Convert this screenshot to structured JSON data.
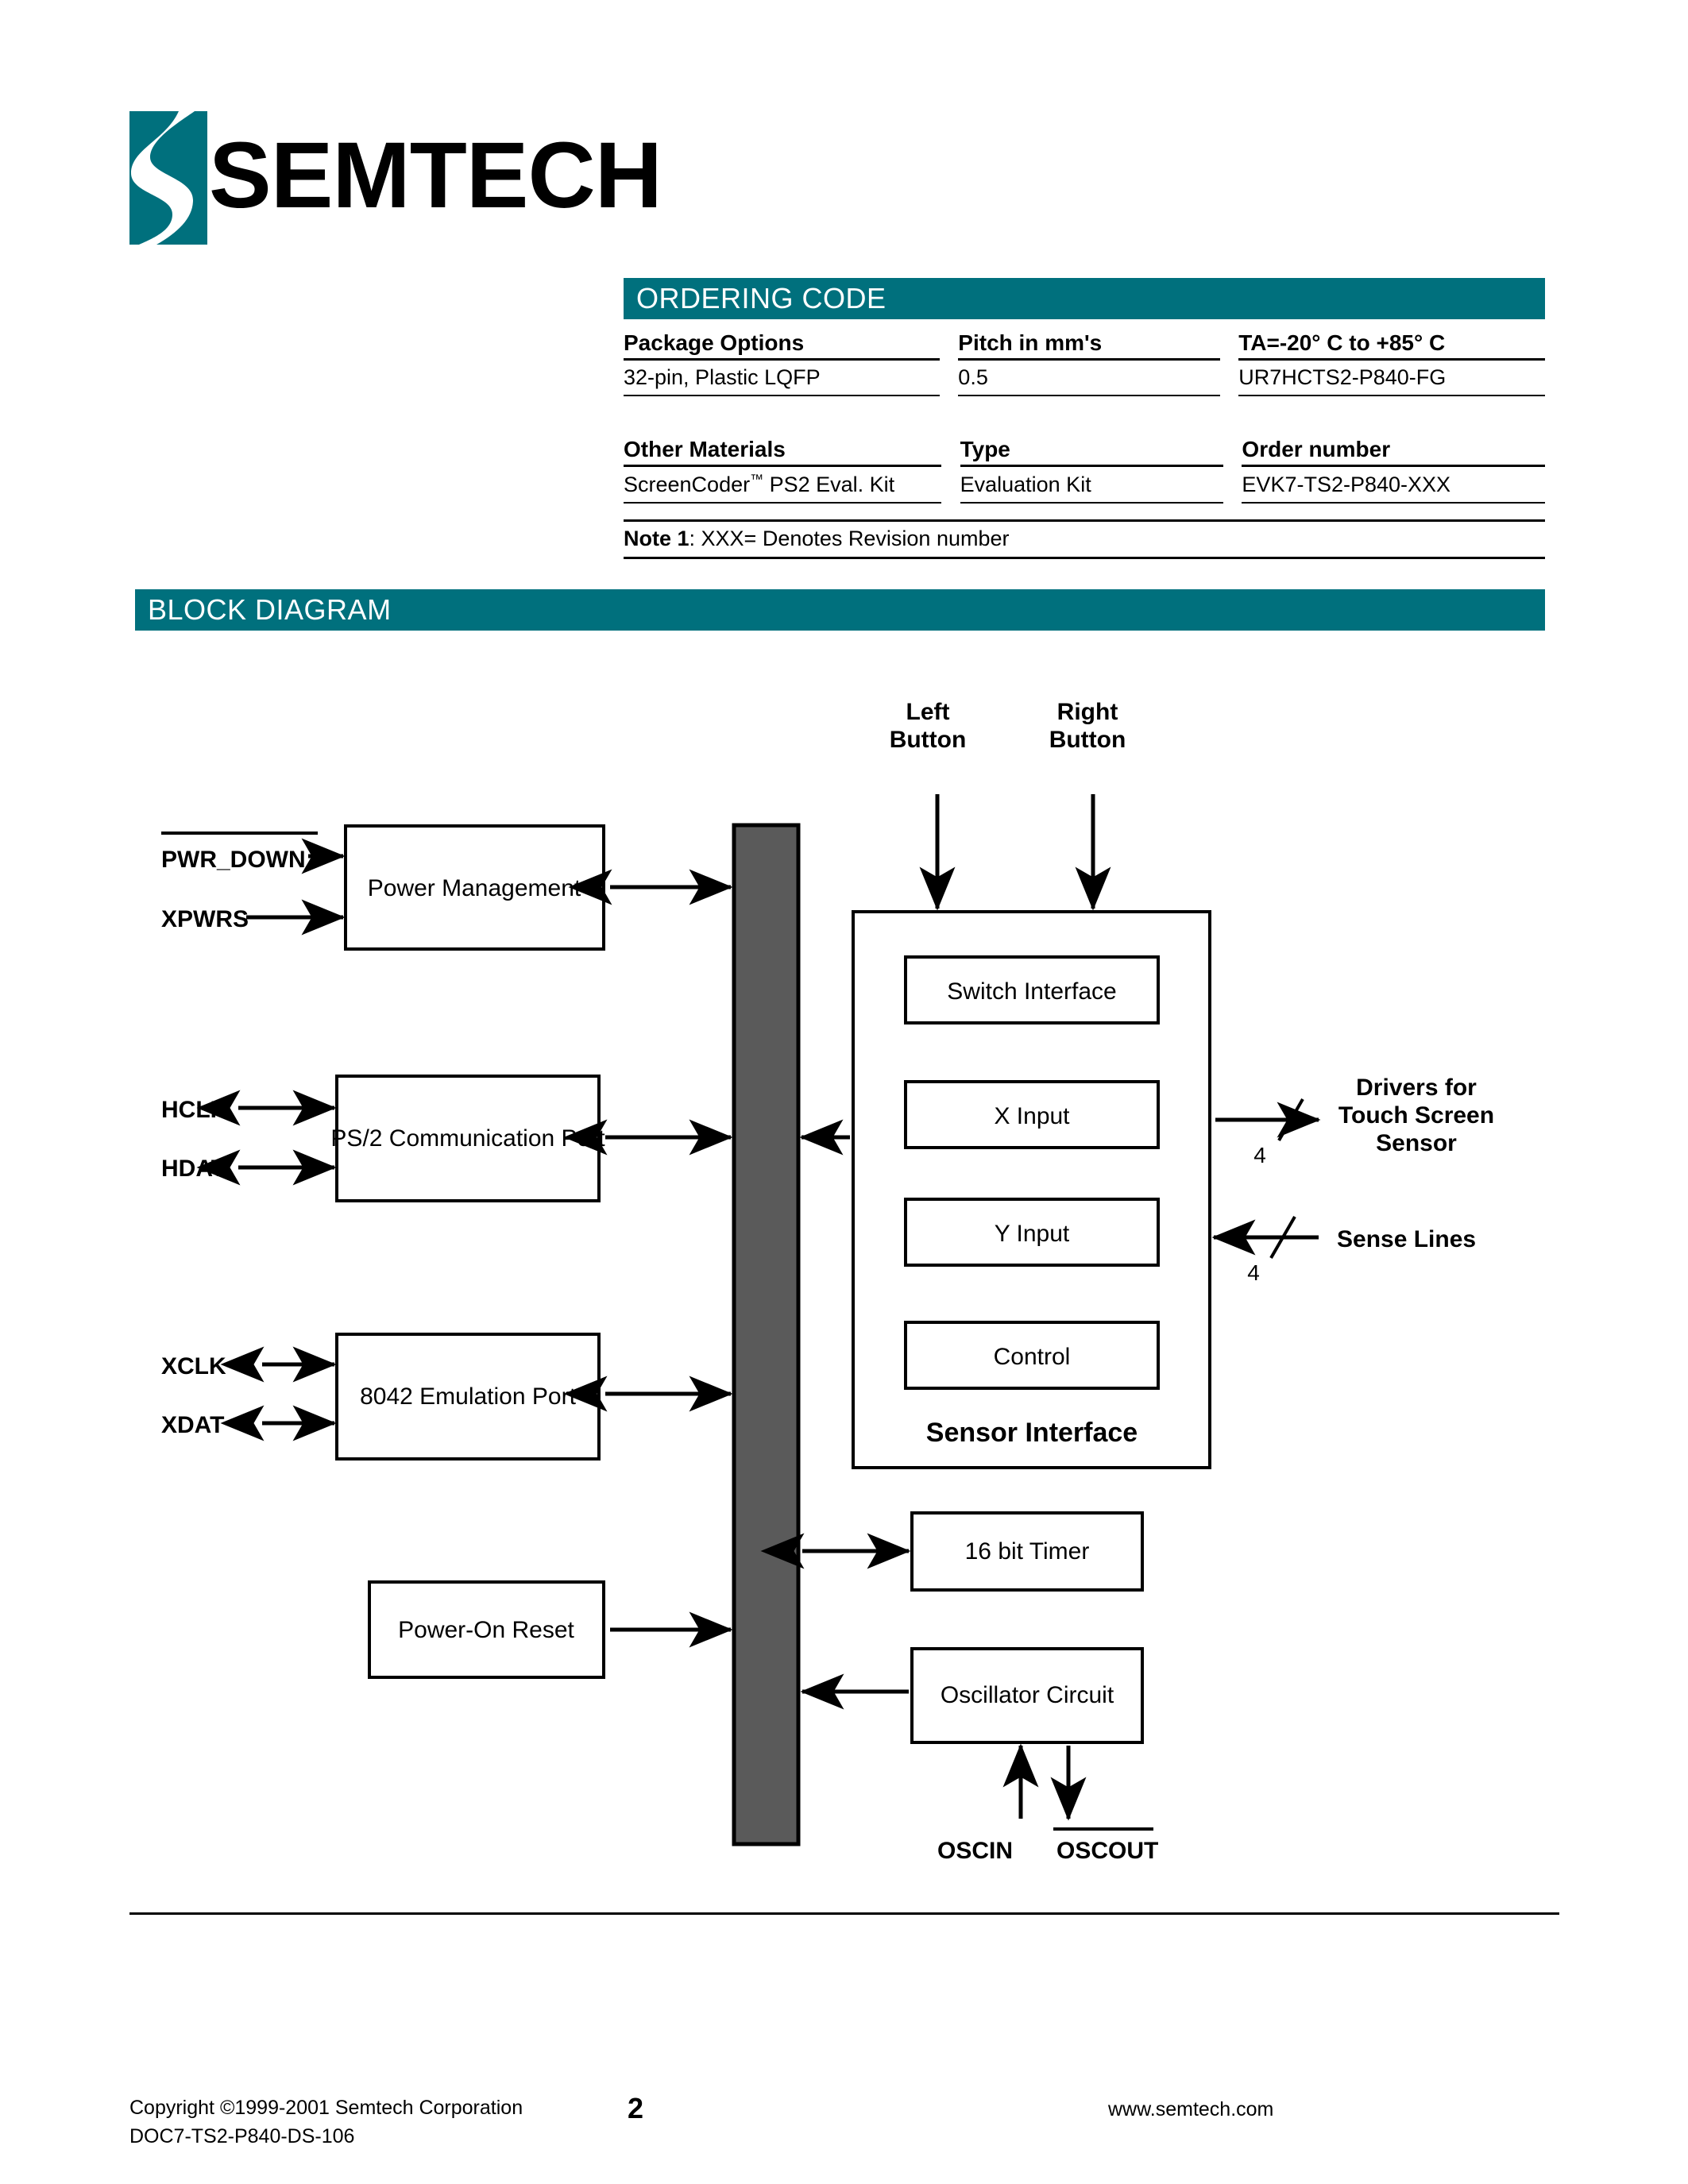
{
  "brand": {
    "name": "SEMTECH",
    "logo_mark": "semtech-s-logo",
    "accent_color": "#00707D"
  },
  "sections": {
    "ordering_code": "ORDERING CODE",
    "block_diagram": "BLOCK DIAGRAM"
  },
  "ordering_table_1": {
    "headers": [
      "Package Options",
      "Pitch in mm's",
      "TA=-20° C to +85° C"
    ],
    "rows": [
      [
        "32-pin, Plastic LQFP",
        "0.5",
        "UR7HCTS2-P840-FG"
      ]
    ]
  },
  "ordering_table_2": {
    "headers": [
      "Other Materials",
      "Type",
      "Order number"
    ],
    "rows": [
      [
        "ScreenCoder™ PS2 Eval. Kit",
        "Evaluation Kit",
        "EVK7-TS2-P840-XXX"
      ]
    ]
  },
  "note": {
    "label": "Note 1",
    "text": ": XXX= Denotes Revision number"
  },
  "diagram": {
    "bus_color": "#5A5A5A",
    "blocks": {
      "power_management": "Power Management",
      "ps2_port": "PS/2 Communication Port",
      "emulation_port": "8042 Emulation Port",
      "power_on_reset": "Power-On Reset",
      "switch_interface": "Switch Interface",
      "x_input": "X Input",
      "y_input": "Y Input",
      "control": "Control",
      "sensor_interface": "Sensor Interface",
      "timer": "16 bit Timer",
      "oscillator": "Oscillator Circuit"
    },
    "pins": {
      "pwr_down": "PWR_DOWN",
      "xpwrs": "XPWRS",
      "hclk": "HCLK",
      "hdat": "HDAT",
      "xclk": "XCLK",
      "xdat": "XDAT",
      "oscin": "OSCIN",
      "oscout": "OSCOUT"
    },
    "external_labels": {
      "left_button_l1": "Left",
      "left_button_l2": "Button",
      "right_button_l1": "Right",
      "right_button_l2": "Button",
      "drivers_l1": "Drivers for",
      "drivers_l2": "Touch Screen",
      "drivers_l3": "Sensor",
      "sense_lines": "Sense Lines"
    },
    "bus_widths": {
      "drivers": "4",
      "sense": "4"
    }
  },
  "footer": {
    "copyright": "Copyright ©1999-2001 Semtech Corporation",
    "doc_id": "DOC7-TS2-P840-DS-106",
    "page": "2",
    "website": "www.semtech.com"
  }
}
